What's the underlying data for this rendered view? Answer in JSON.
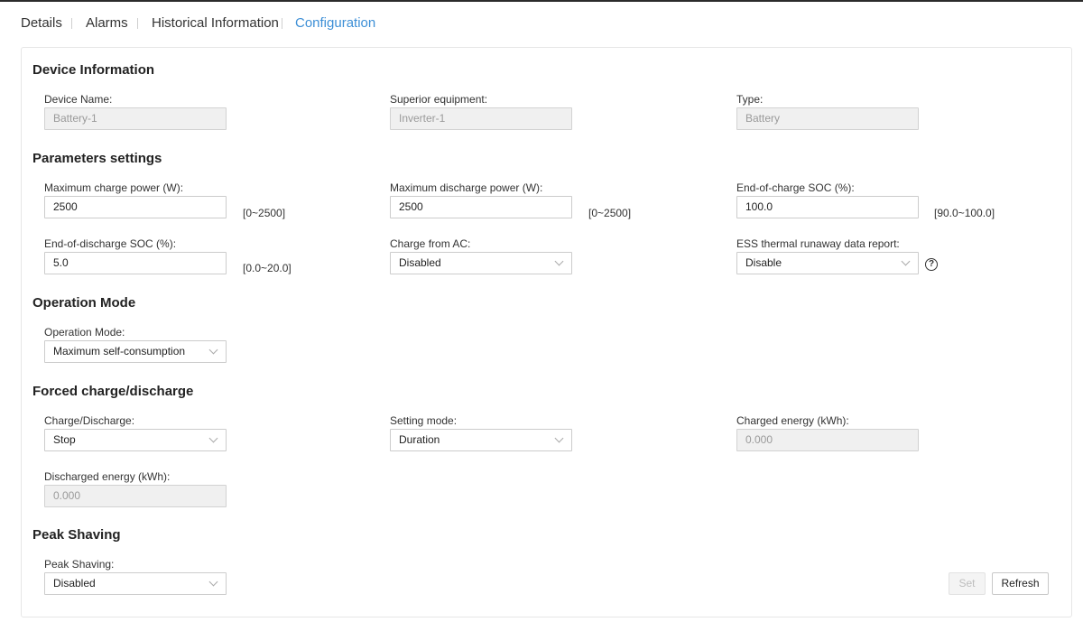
{
  "tabs": [
    {
      "label": "Details",
      "active": false
    },
    {
      "label": "Alarms",
      "active": false
    },
    {
      "label": "Historical Information",
      "active": false
    },
    {
      "label": "Configuration",
      "active": true
    }
  ],
  "colors": {
    "accent": "#3d8fd6",
    "disabled_bg": "#f0f0f0",
    "border": "#cccccc"
  },
  "device_info": {
    "title": "Device Information",
    "device_name": {
      "label": "Device Name:",
      "value": "Battery-1"
    },
    "superior_equipment": {
      "label": "Superior equipment:",
      "value": "Inverter-1"
    },
    "type": {
      "label": "Type:",
      "value": "Battery"
    }
  },
  "parameters": {
    "title": "Parameters settings",
    "max_charge_power": {
      "label": "Maximum charge power (W):",
      "value": "2500",
      "range": "[0~2500]"
    },
    "max_discharge_power": {
      "label": "Maximum discharge power (W):",
      "value": "2500",
      "range": "[0~2500]"
    },
    "end_of_charge_soc": {
      "label": "End-of-charge SOC (%):",
      "value": "100.0",
      "range": "[90.0~100.0]"
    },
    "end_of_discharge_soc": {
      "label": "End-of-discharge SOC (%):",
      "value": "5.0",
      "range": "[0.0~20.0]"
    },
    "charge_from_ac": {
      "label": "Charge from AC:",
      "value": "Disabled"
    },
    "ess_thermal_report": {
      "label": "ESS thermal runaway data report:",
      "value": "Disable",
      "help_icon": "question-circle-icon",
      "help_glyph": "?"
    }
  },
  "operation_mode": {
    "title": "Operation Mode",
    "mode": {
      "label": "Operation Mode:",
      "value": "Maximum self-consumption"
    }
  },
  "forced": {
    "title": "Forced charge/discharge",
    "charge_discharge": {
      "label": "Charge/Discharge:",
      "value": "Stop"
    },
    "setting_mode": {
      "label": "Setting mode:",
      "value": "Duration"
    },
    "charged_energy": {
      "label": "Charged energy (kWh):",
      "value": "0.000"
    },
    "discharged_energy": {
      "label": "Discharged energy (kWh):",
      "value": "0.000"
    }
  },
  "peak_shaving": {
    "title": "Peak Shaving",
    "peak": {
      "label": "Peak Shaving:",
      "value": "Disabled"
    }
  },
  "actions": {
    "set_label": "Set",
    "refresh_label": "Refresh"
  }
}
